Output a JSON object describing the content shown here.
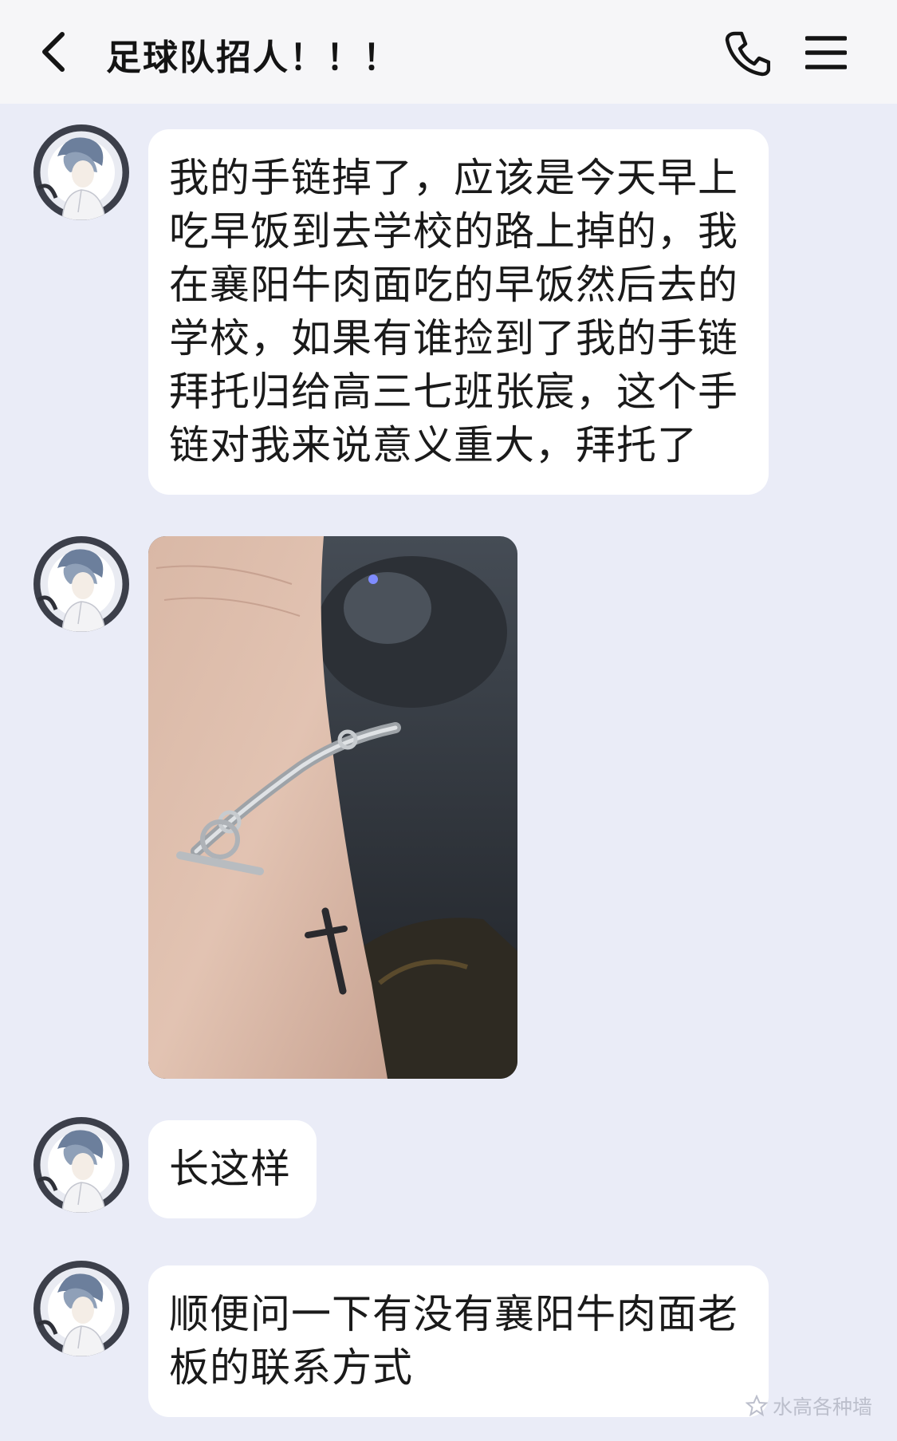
{
  "header": {
    "back_icon": "chevron-left-icon",
    "title": "足球队招人！！！",
    "call_icon": "phone-icon",
    "menu_icon": "hamburger-menu-icon"
  },
  "messages": [
    {
      "type": "text",
      "avatar_icon": "anime-character-avatar",
      "text": "我的手链掉了，应该是今天早上吃早饭到去学校的路上掉的，我在襄阳牛肉面吃的早饭然后去的学校，如果有谁捡到了我的手链拜托归给高三七班张宸，这个手链对我来说意义重大，拜托了"
    },
    {
      "type": "image",
      "avatar_icon": "anime-character-avatar",
      "image_description_icon": "photo-bracelet-on-wrist"
    },
    {
      "type": "text",
      "avatar_icon": "anime-character-avatar",
      "text": "长这样"
    },
    {
      "type": "text",
      "avatar_icon": "anime-character-avatar",
      "text": "顺便问一下有没有襄阳牛肉面老板的联系方式"
    }
  ],
  "watermark": {
    "icon": "star-logo-icon",
    "text": "水高各种墙"
  },
  "colors": {
    "background": "#eaecf7",
    "header_bg": "#f6f6f8",
    "bubble_bg": "#ffffff",
    "text": "#1a1a1a"
  }
}
